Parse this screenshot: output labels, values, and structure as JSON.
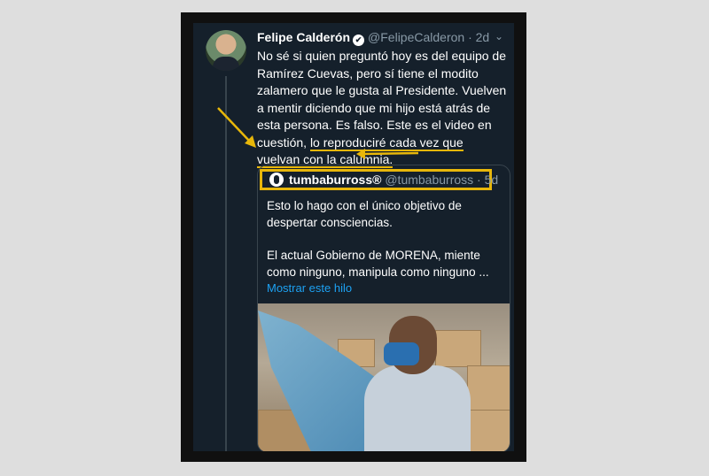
{
  "tweet": {
    "author_name": "Felipe Calderón",
    "verified_badge": "✔",
    "handle": "@FelipeCalderon",
    "separator": "·",
    "time": "2d",
    "menu_icon": "chevron-down-icon",
    "text_part1": "No sé si quien preguntó hoy es del equipo de Ramírez Cuevas, pero sí tiene el modito zalamero que le gusta al Presidente. Vuelven a mentir diciendo que mi hijo está atrás de esta persona. Es falso. Este es el video en cuestión, ",
    "text_highlight": "lo reproduciré cada vez que vuelvan con la calumnia.",
    "quoted": {
      "author_name": "tumbaburross®",
      "handle": "@tumbaburross",
      "separator": "·",
      "time": "5d",
      "paragraph1": "Esto lo hago con el único objetivo de despertar consciencias.",
      "paragraph2": "El actual Gobierno de MORENA, miente como ninguno, manipula como ninguno ...",
      "thread_link": "Mostrar este hilo"
    }
  },
  "colors": {
    "background": "#15202b",
    "highlight": "#e8b70a",
    "link": "#1da1f2",
    "muted": "#8899a6"
  }
}
